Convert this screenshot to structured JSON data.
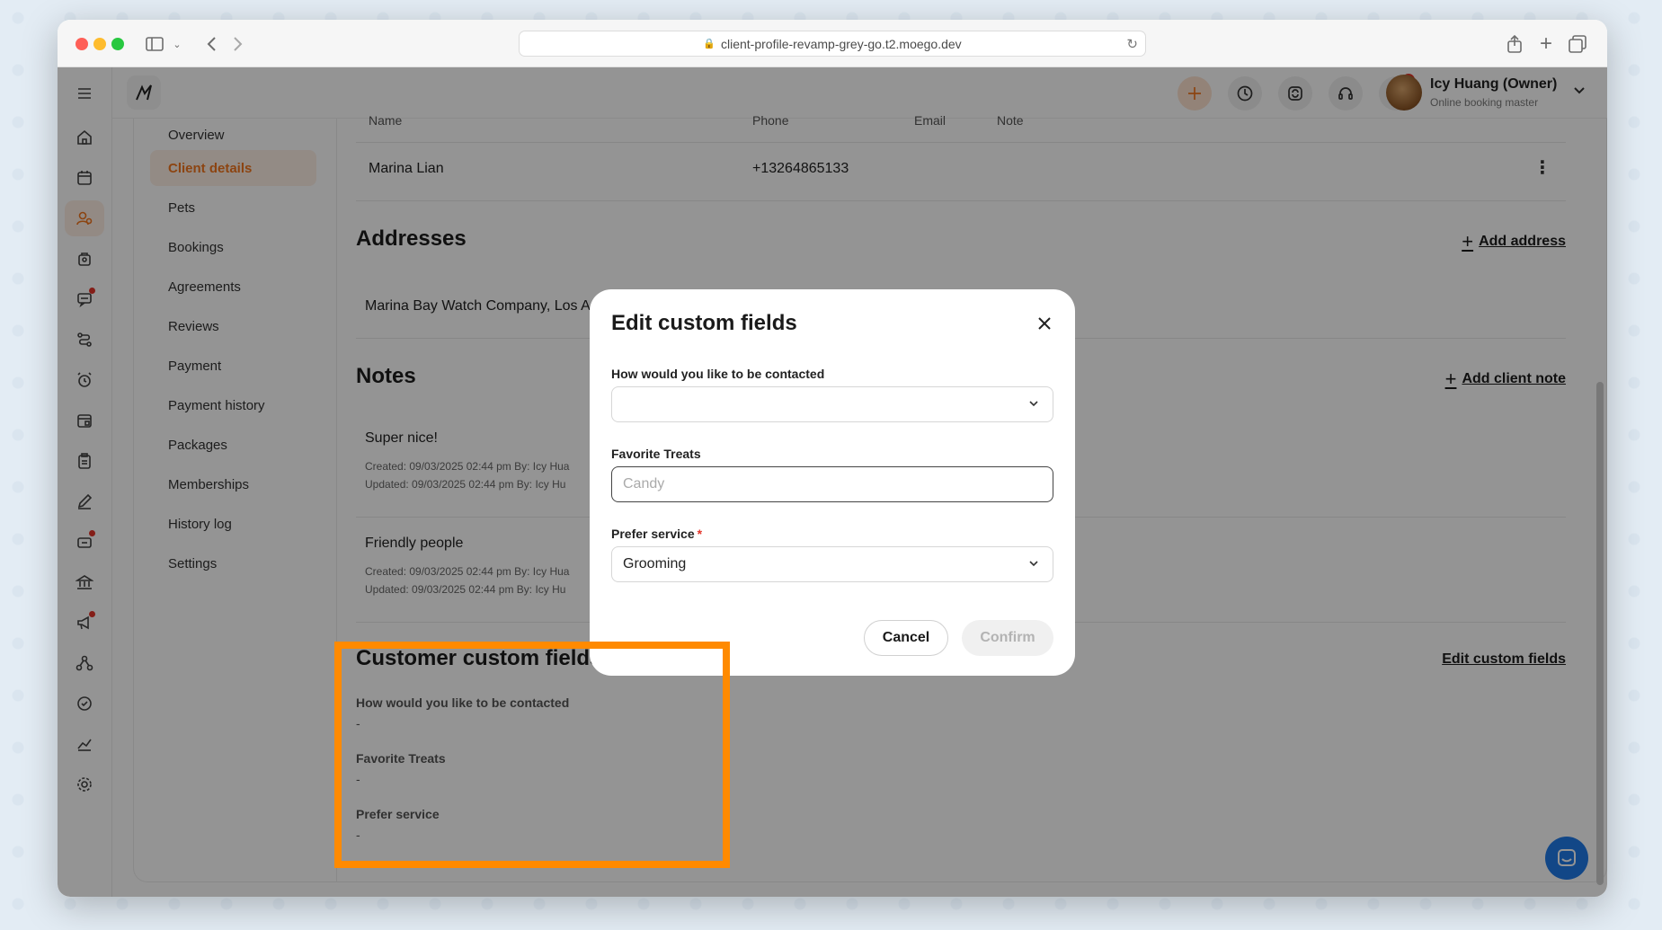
{
  "browser": {
    "url": "client-profile-revamp-grey-go.t2.moego.dev"
  },
  "topbar": {
    "user_name": "Icy Huang (Owner)",
    "user_role": "Online booking master",
    "notification_count": "4"
  },
  "subnav": {
    "items": [
      {
        "label": "Overview"
      },
      {
        "label": "Client details"
      },
      {
        "label": "Pets"
      },
      {
        "label": "Bookings"
      },
      {
        "label": "Agreements"
      },
      {
        "label": "Reviews"
      },
      {
        "label": "Payment"
      },
      {
        "label": "Payment history"
      },
      {
        "label": "Packages"
      },
      {
        "label": "Memberships"
      },
      {
        "label": "History log"
      },
      {
        "label": "Settings"
      }
    ],
    "active": "Client details"
  },
  "contacts": {
    "headers": {
      "name": "Name",
      "phone": "Phone",
      "email": "Email",
      "note": "Note"
    },
    "rows": [
      {
        "name": "Marina Lian",
        "phone": "+13264865133"
      }
    ]
  },
  "addresses": {
    "title": "Addresses",
    "add_label": "Add address",
    "items": [
      {
        "text": "Marina Bay Watch Company, Los A"
      }
    ]
  },
  "notes": {
    "title": "Notes",
    "add_label": "Add client note",
    "items": [
      {
        "title": "Super nice!",
        "created": "Created: 09/03/2025 02:44 pm By: Icy Hua",
        "updated": "Updated: 09/03/2025 02:44 pm By: Icy Hu"
      },
      {
        "title": "Friendly people",
        "created": "Created: 09/03/2025 02:44 pm By: Icy Hua",
        "updated": "Updated: 09/03/2025 02:44 pm By: Icy Hu"
      }
    ]
  },
  "custom_fields": {
    "title": "Customer custom fields",
    "edit_label": "Edit custom fields",
    "fields": [
      {
        "label": "How would you like to be contacted",
        "value": "-"
      },
      {
        "label": "Favorite Treats",
        "value": "-"
      },
      {
        "label": "Prefer service",
        "value": "-"
      }
    ]
  },
  "modal": {
    "title": "Edit custom fields",
    "contact_label": "How would you like to be contacted",
    "contact_value": "",
    "treats_label": "Favorite Treats",
    "treats_placeholder": "Candy",
    "service_label": "Prefer service",
    "service_required": "*",
    "service_value": "Grooming",
    "cancel_label": "Cancel",
    "confirm_label": "Confirm"
  },
  "colors": {
    "accent": "#f2761e",
    "highlight": "#ff8a00",
    "notification": "#e3352a"
  }
}
